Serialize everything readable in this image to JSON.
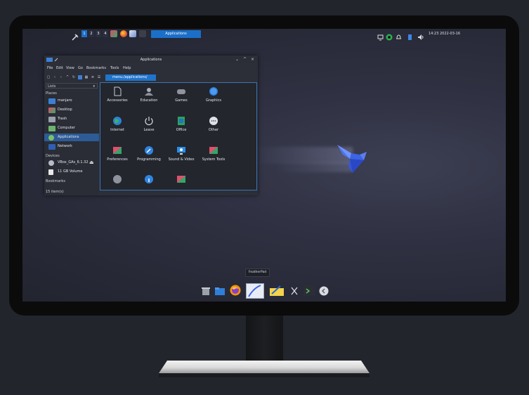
{
  "topbar": {
    "workspaces": [
      "1",
      "2",
      "3",
      "4"
    ],
    "active_task": "Applications",
    "clock": "14:23  2022-03-16"
  },
  "window": {
    "title": "Applications",
    "controls": [
      "⌄",
      "^",
      "×"
    ],
    "menu": [
      "File",
      "Edit",
      "View",
      "Go",
      "Bookmarks",
      "Tools",
      "Help"
    ],
    "location": "menu:/applications/",
    "sidebar": {
      "dropdown": "Lists",
      "places_header": "Places",
      "places": [
        "manjaro",
        "Desktop",
        "Trash",
        "Computer",
        "Applications",
        "Network"
      ],
      "devices_header": "Devices",
      "devices": [
        "VBox_GAs_6.1.32",
        "11 GB Volume"
      ],
      "bookmarks_header": "Bookmarks",
      "status": "15 item(s)"
    },
    "categories": [
      "Accessories",
      "Education",
      "Games",
      "Graphics",
      "Internet",
      "Leave",
      "Office",
      "Other",
      "Preferences",
      "Programming",
      "Sound & Video",
      "System Tools",
      "",
      "",
      ""
    ]
  },
  "dock": {
    "tooltip": "FeatherPad"
  },
  "colors": {
    "accent": "#1f74cc",
    "selection": "#2c5b96",
    "bird": "#3b64e6"
  }
}
